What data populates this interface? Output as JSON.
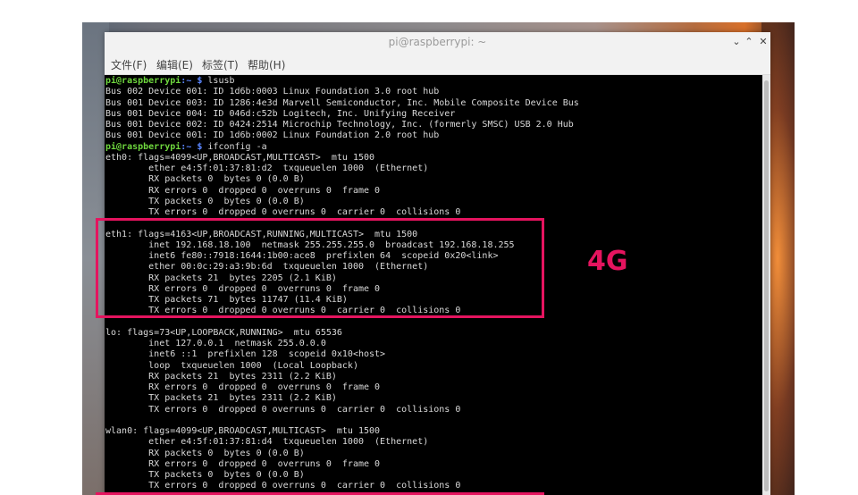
{
  "window": {
    "title": "pi@raspberrypi: ~",
    "buttons": {
      "minimize": "⌄",
      "maximize": "⌃",
      "close": "✕"
    }
  },
  "menu": [
    "文件(F)",
    "编辑(E)",
    "标签(T)",
    "帮助(H)"
  ],
  "terminal": {
    "prompt_user": "pi@raspberrypi",
    "prompt_path": ":~ $",
    "lines": [
      {
        "type": "prompt",
        "cmd": " lsusb"
      },
      {
        "type": "out",
        "text": "Bus 002 Device 001: ID 1d6b:0003 Linux Foundation 3.0 root hub"
      },
      {
        "type": "out",
        "text": "Bus 001 Device 003: ID 1286:4e3d Marvell Semiconductor, Inc. Mobile Composite Device Bus"
      },
      {
        "type": "out",
        "text": "Bus 001 Device 004: ID 046d:c52b Logitech, Inc. Unifying Receiver"
      },
      {
        "type": "out",
        "text": "Bus 001 Device 002: ID 0424:2514 Microchip Technology, Inc. (formerly SMSC) USB 2.0 Hub"
      },
      {
        "type": "out",
        "text": "Bus 001 Device 001: ID 1d6b:0002 Linux Foundation 2.0 root hub"
      },
      {
        "type": "prompt",
        "cmd": " ifconfig -a"
      },
      {
        "type": "out",
        "text": "eth0: flags=4099<UP,BROADCAST,MULTICAST>  mtu 1500"
      },
      {
        "type": "out",
        "text": "        ether e4:5f:01:37:81:d2  txqueuelen 1000  (Ethernet)"
      },
      {
        "type": "out",
        "text": "        RX packets 0  bytes 0 (0.0 B)"
      },
      {
        "type": "out",
        "text": "        RX errors 0  dropped 0  overruns 0  frame 0"
      },
      {
        "type": "out",
        "text": "        TX packets 0  bytes 0 (0.0 B)"
      },
      {
        "type": "out",
        "text": "        TX errors 0  dropped 0 overruns 0  carrier 0  collisions 0"
      },
      {
        "type": "out",
        "text": ""
      },
      {
        "type": "out",
        "text": "eth1: flags=4163<UP,BROADCAST,RUNNING,MULTICAST>  mtu 1500"
      },
      {
        "type": "out",
        "text": "        inet 192.168.18.100  netmask 255.255.255.0  broadcast 192.168.18.255"
      },
      {
        "type": "out",
        "text": "        inet6 fe80::7918:1644:1b00:ace8  prefixlen 64  scopeid 0x20<link>"
      },
      {
        "type": "out",
        "text": "        ether 00:0c:29:a3:9b:6d  txqueuelen 1000  (Ethernet)"
      },
      {
        "type": "out",
        "text": "        RX packets 21  bytes 2205 (2.1 KiB)"
      },
      {
        "type": "out",
        "text": "        RX errors 0  dropped 0  overruns 0  frame 0"
      },
      {
        "type": "out",
        "text": "        TX packets 71  bytes 11747 (11.4 KiB)"
      },
      {
        "type": "out",
        "text": "        TX errors 0  dropped 0 overruns 0  carrier 0  collisions 0"
      },
      {
        "type": "out",
        "text": ""
      },
      {
        "type": "out",
        "text": "lo: flags=73<UP,LOOPBACK,RUNNING>  mtu 65536"
      },
      {
        "type": "out",
        "text": "        inet 127.0.0.1  netmask 255.0.0.0"
      },
      {
        "type": "out",
        "text": "        inet6 ::1  prefixlen 128  scopeid 0x10<host>"
      },
      {
        "type": "out",
        "text": "        loop  txqueuelen 1000  (Local Loopback)"
      },
      {
        "type": "out",
        "text": "        RX packets 21  bytes 2311 (2.2 KiB)"
      },
      {
        "type": "out",
        "text": "        RX errors 0  dropped 0  overruns 0  frame 0"
      },
      {
        "type": "out",
        "text": "        TX packets 21  bytes 2311 (2.2 KiB)"
      },
      {
        "type": "out",
        "text": "        TX errors 0  dropped 0 overruns 0  carrier 0  collisions 0"
      },
      {
        "type": "out",
        "text": ""
      },
      {
        "type": "out",
        "text": "wlan0: flags=4099<UP,BROADCAST,MULTICAST>  mtu 1500"
      },
      {
        "type": "out",
        "text": "        ether e4:5f:01:37:81:d4  txqueuelen 1000  (Ethernet)"
      },
      {
        "type": "out",
        "text": "        RX packets 0  bytes 0 (0.0 B)"
      },
      {
        "type": "out",
        "text": "        RX errors 0  dropped 0  overruns 0  frame 0"
      },
      {
        "type": "out",
        "text": "        TX packets 0  bytes 0 (0.0 B)"
      },
      {
        "type": "out",
        "text": "        TX errors 0  dropped 0 overruns 0  carrier 0  collisions 0"
      }
    ]
  },
  "annotation": {
    "label": "4G",
    "color": "#e5145f"
  },
  "colors": {
    "prompt_user": "#6fd83e",
    "prompt_path": "#5b86ff",
    "terminal_bg": "#000000",
    "terminal_fg": "#d9d9d9"
  }
}
